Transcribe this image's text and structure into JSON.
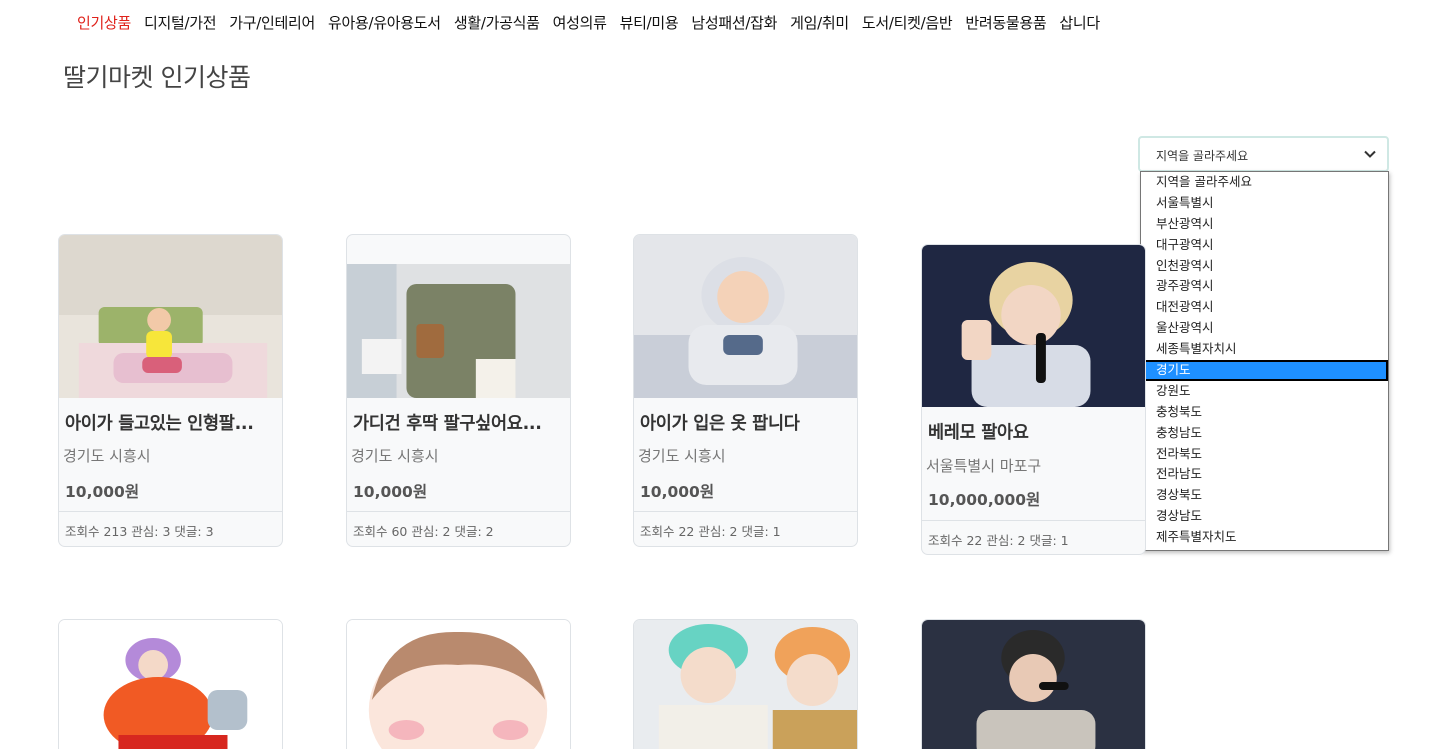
{
  "nav": {
    "items": [
      "인기상품",
      "디지털/가전",
      "가구/인테리어",
      "유아용/유아용도서",
      "생활/가공식품",
      "여성의류",
      "뷰티/미용",
      "남성패션/잡화",
      "게임/취미",
      "도서/티켓/음반",
      "반려동물용품",
      "삽니다"
    ],
    "active_index": 0
  },
  "page_title": "딸기마켓 인기상품",
  "region": {
    "selected": "지역을 골라주세요",
    "options": [
      "지역을 골라주세요",
      "서울특별시",
      "부산광역시",
      "대구광역시",
      "인천광역시",
      "광주광역시",
      "대전광역시",
      "울산광역시",
      "세종특별자치시",
      "경기도",
      "강원도",
      "충청북도",
      "충청남도",
      "전라북도",
      "전라남도",
      "경상북도",
      "경상남도",
      "제주특별자치도"
    ],
    "highlighted": "경기도"
  },
  "products": [
    {
      "title": "아이가 들고있는 인형팔...",
      "location": "경기도 시흥시",
      "price": "10,000원",
      "stats": "조회수 213 관심: 3 댓글: 3"
    },
    {
      "title": "가디건 후딱 팔구싶어요...",
      "location": "경기도 시흥시",
      "price": "10,000원",
      "stats": "조회수 60 관심: 2 댓글: 2"
    },
    {
      "title": "아이가 입은 옷 팝니다",
      "location": "경기도 시흥시",
      "price": "10,000원",
      "stats": "조회수 22 관심: 2 댓글: 1"
    },
    {
      "title": "베레모 팔아요",
      "location": "서울특별시 마포구",
      "price": "10,000,000원",
      "stats": "조회수 22 관심: 2 댓글: 1"
    }
  ],
  "colors": {
    "active_nav": "#e0221b",
    "highlight": "#1e90ff"
  }
}
